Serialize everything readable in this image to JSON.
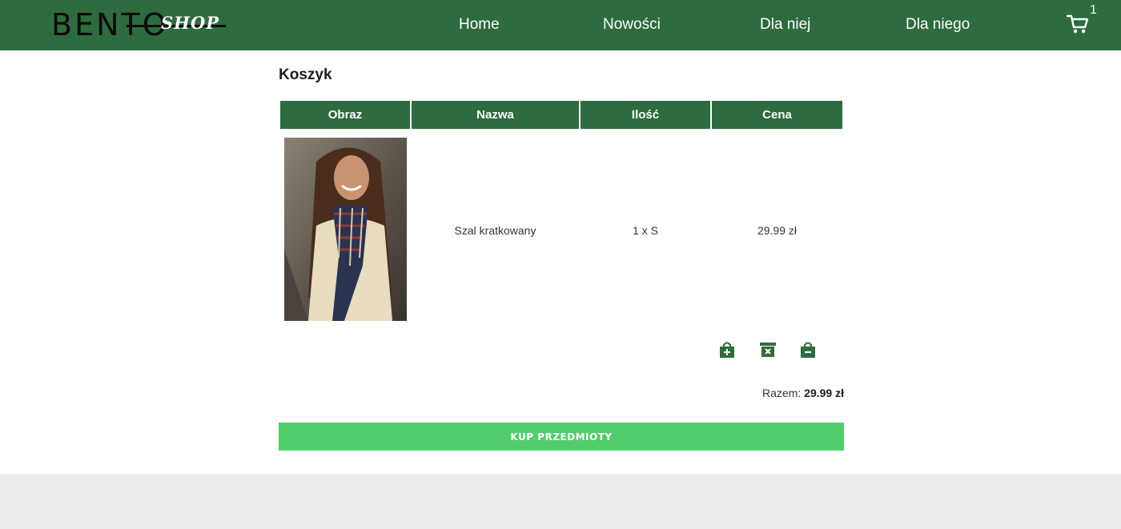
{
  "header": {
    "logo_main": "BENTO",
    "logo_sub": "SHOP",
    "nav": [
      "Home",
      "Nowości",
      "Dla niej",
      "Dla niego"
    ],
    "cart_count": "1",
    "cart_icon": "cart-icon"
  },
  "page": {
    "title": "Koszyk"
  },
  "table": {
    "headers": [
      "Obraz",
      "Nazwa",
      "Ilość",
      "Cena"
    ],
    "rows": [
      {
        "name": "Szal kratkowany",
        "quantity": "1 x S",
        "price": "29.99 zł"
      }
    ]
  },
  "actions": [
    "add-to-bag-icon",
    "remove-item-icon",
    "decrease-quantity-icon"
  ],
  "summary": {
    "total_label": "Razem:",
    "total_value": "29.99 zł"
  },
  "buy_button": "KUP PRZEDMIOTY",
  "colors": {
    "header": "#2e6b3e",
    "buy_button": "#52cc6c",
    "footer": "#ececec"
  }
}
